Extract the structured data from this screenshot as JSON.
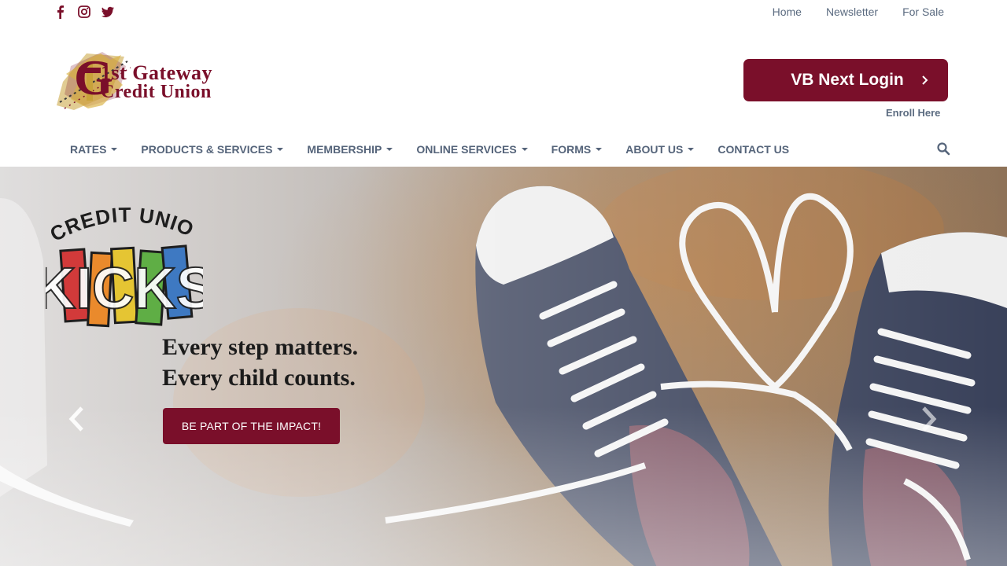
{
  "social": {
    "icons": [
      "facebook-icon",
      "instagram-icon",
      "twitter-icon"
    ]
  },
  "top_links": {
    "home": "Home",
    "newsletter": "Newsletter",
    "for_sale": "For Sale"
  },
  "logo": {
    "line1": "1st Gateway",
    "line2": "Credit Union",
    "monogram": "G"
  },
  "login": {
    "button_label": "VB Next Login",
    "enroll_label": "Enroll Here"
  },
  "nav": {
    "items": [
      {
        "label": "RATES",
        "dropdown": true
      },
      {
        "label": "PRODUCTS & SERVICES",
        "dropdown": true
      },
      {
        "label": "MEMBERSHIP",
        "dropdown": true
      },
      {
        "label": "ONLINE SERVICES",
        "dropdown": true
      },
      {
        "label": "FORMS",
        "dropdown": true
      },
      {
        "label": "ABOUT US",
        "dropdown": true
      },
      {
        "label": "CONTACT US",
        "dropdown": false
      }
    ]
  },
  "hero": {
    "badge_top": "CREDIT UNION",
    "badge_word": "KICKS",
    "tagline_1": "Every step matters.",
    "tagline_2": "Every child counts.",
    "cta_label": "BE PART OF THE IMPACT!"
  },
  "colors": {
    "brand": "#7a0f2a",
    "nav_text": "#55647a",
    "link_text": "#5b6b80"
  }
}
